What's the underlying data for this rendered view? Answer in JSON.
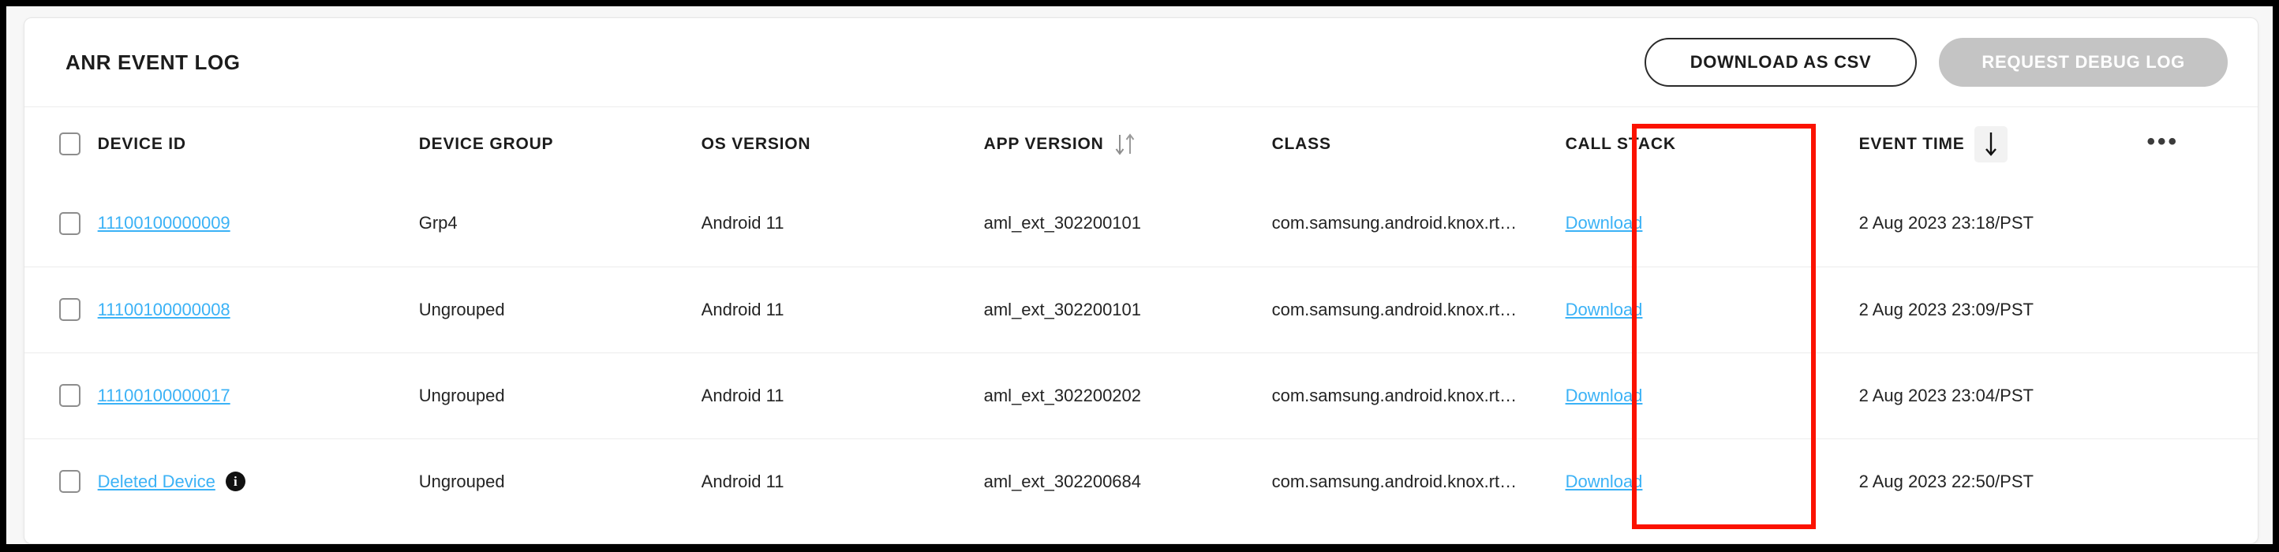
{
  "card": {
    "title": "ANR EVENT LOG"
  },
  "toolbar": {
    "download_csv_label": "DOWNLOAD AS CSV",
    "request_debug_log_label": "REQUEST DEBUG LOG"
  },
  "table": {
    "columns": [
      {
        "key": "select",
        "label": "",
        "sort": "none"
      },
      {
        "key": "device_id",
        "label": "DEVICE ID",
        "sort": "none"
      },
      {
        "key": "device_group",
        "label": "DEVICE GROUP",
        "sort": "none"
      },
      {
        "key": "os_version",
        "label": "OS VERSION",
        "sort": "none"
      },
      {
        "key": "app_version",
        "label": "APP VERSION",
        "sort": "sortable"
      },
      {
        "key": "class",
        "label": "CLASS",
        "sort": "none"
      },
      {
        "key": "call_stack",
        "label": "CALL STACK",
        "sort": "none"
      },
      {
        "key": "event_time",
        "label": "EVENT TIME",
        "sort": "desc"
      },
      {
        "key": "more",
        "label": "",
        "sort": "none"
      }
    ],
    "rows": [
      {
        "device_id": "11100100000009",
        "deleted": false,
        "device_group": "Grp4",
        "os_version": "Android 11",
        "app_version": "aml_ext_302200101",
        "class": "com.samsung.android.knox.rt…",
        "call_stack": "Download",
        "event_time": "2 Aug 2023 23:18/PST"
      },
      {
        "device_id": "11100100000008",
        "deleted": false,
        "device_group": "Ungrouped",
        "os_version": "Android 11",
        "app_version": "aml_ext_302200101",
        "class": "com.samsung.android.knox.rt…",
        "call_stack": "Download",
        "event_time": "2 Aug 2023 23:09/PST"
      },
      {
        "device_id": "11100100000017",
        "deleted": false,
        "device_group": "Ungrouped",
        "os_version": "Android 11",
        "app_version": "aml_ext_302200202",
        "class": "com.samsung.android.knox.rt…",
        "call_stack": "Download",
        "event_time": "2 Aug 2023 23:04/PST"
      },
      {
        "device_id": "Deleted Device",
        "deleted": true,
        "device_group": "Ungrouped",
        "os_version": "Android 11",
        "app_version": "aml_ext_302200684",
        "class": "com.samsung.android.knox.rt…",
        "call_stack": "Download",
        "event_time": "2 Aug 2023 22:50/PST"
      }
    ],
    "more_label": "•••",
    "info_glyph": "i"
  },
  "annotation": {
    "color": "#fb1200",
    "target_column": "CALL STACK"
  },
  "colors": {
    "link": "#3bb2f6",
    "annotation": "#fb1200",
    "disabled_button": "#c4c4c4"
  }
}
